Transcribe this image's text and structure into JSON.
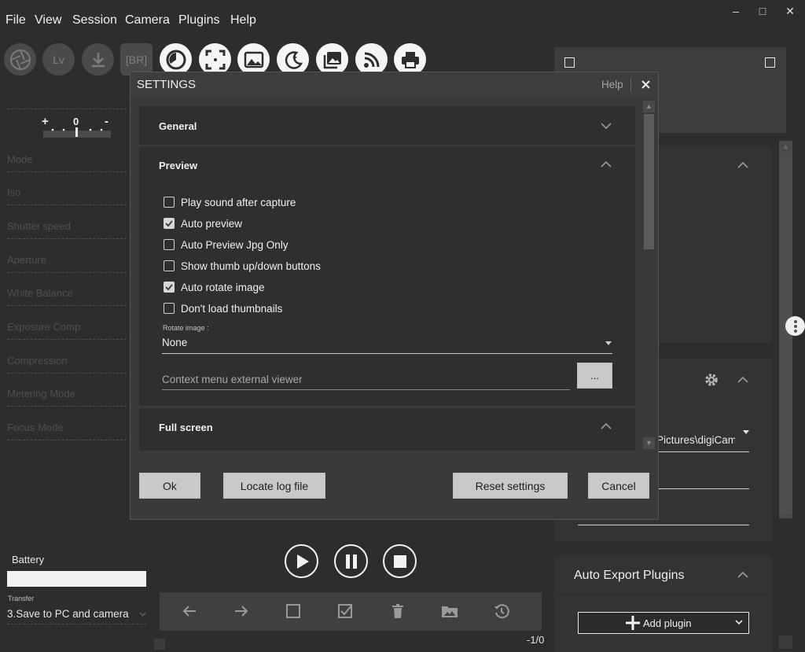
{
  "menu": {
    "items": [
      "File",
      "View",
      "Session",
      "Camera",
      "Plugins",
      "Help"
    ]
  },
  "window_controls": {
    "minimize": "–",
    "maximize": "□",
    "close": "✕"
  },
  "toolbar": {
    "lv_label": "Lv",
    "br_label": "[BR]",
    "icons": [
      "aperture-icon",
      "lv-icon",
      "download-icon",
      "bracketing-icon",
      "timelapse-icon",
      "focus-frame-icon",
      "image-icon",
      "night-mode-icon",
      "gallery-icon",
      "wireless-icon",
      "print-icon"
    ]
  },
  "exposure_scale": {
    "plus": "+",
    "zero": "0",
    "minus": "-"
  },
  "left_panel": {
    "fields": [
      "Mode",
      "Iso",
      "Shutter speed",
      "Aperture",
      "White Balance",
      "Exposure Comp.",
      "Compression",
      "Metering Mode",
      "Focus Mode"
    ],
    "battery_label": "Battery",
    "transfer_label": "Transfer",
    "transfer_value": "3.Save to PC and camera"
  },
  "right_panel": {
    "path_value": "Pictures\\digiCam",
    "auto_export_title": "Auto Export Plugins",
    "add_plugin_label": "Add plugin"
  },
  "dialog": {
    "title": "SETTINGS",
    "help_label": "Help",
    "sections": {
      "general": "General",
      "preview": "Preview",
      "fullscreen": "Full screen"
    },
    "preview_options": [
      {
        "label": "Play sound after capture",
        "checked": false
      },
      {
        "label": "Auto preview",
        "checked": true
      },
      {
        "label": "Auto Preview Jpg Only",
        "checked": false
      },
      {
        "label": "Show thumb up/down buttons",
        "checked": false
      },
      {
        "label": "Auto rotate image",
        "checked": true
      },
      {
        "label": "Don't load thumbnails",
        "checked": false
      }
    ],
    "rotate_label": "Rotate image :",
    "rotate_value": "None",
    "context_menu_placeholder": "Context menu external viewer",
    "browse_label": "...",
    "buttons": {
      "ok": "Ok",
      "locate_log": "Locate log file",
      "reset": "Reset settings",
      "cancel": "Cancel"
    }
  },
  "counter": "-1/0"
}
